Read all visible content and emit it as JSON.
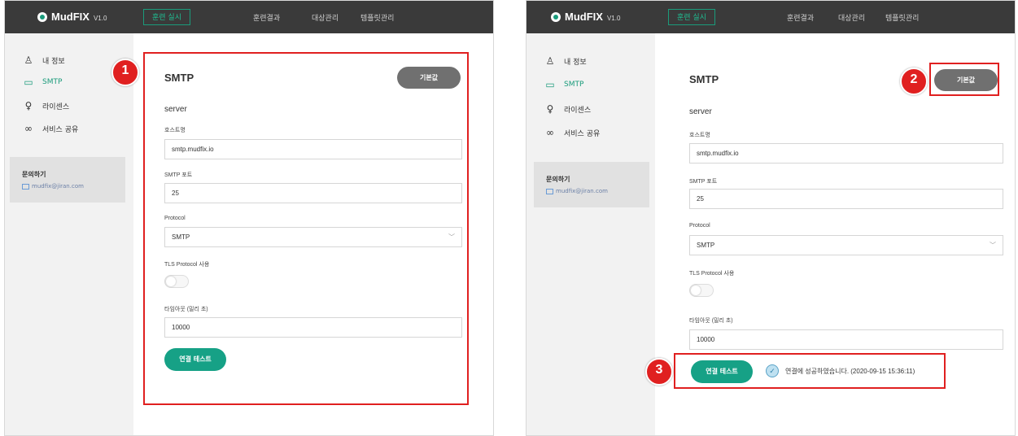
{
  "app": {
    "logo_text": "MudFIX",
    "version": "V1.0"
  },
  "nav": {
    "active": "훈련 실시",
    "items": [
      "훈련결과",
      "대상관리",
      "템플릿관리"
    ]
  },
  "sidebar": {
    "items": [
      {
        "label": "내 정보",
        "icon": "user-icon"
      },
      {
        "label": "SMTP",
        "icon": "monitor-icon",
        "active": true
      },
      {
        "label": "라이센스",
        "icon": "award-icon"
      },
      {
        "label": "서비스 공유",
        "icon": "link-icon"
      }
    ],
    "contact_title": "문의하기",
    "contact_email": "mudfix@jiran.com"
  },
  "form": {
    "title": "SMTP",
    "default_button": "기본값",
    "section": "server",
    "host_label": "호스트명",
    "host_value": "smtp.mudfix.io",
    "port_label": "SMTP 포트",
    "port_value": "25",
    "protocol_label": "Protocol",
    "protocol_value": "SMTP",
    "tls_label": "TLS Protocol 사용",
    "tls_enabled": false,
    "timeout_label": "타임아웃 (밀리 초)",
    "timeout_value": "10000",
    "test_button": "연결 테스트",
    "success_message": "연결에 성공하였습니다. (2020-09-15 15:36:11)"
  },
  "annotations": {
    "badge1": "1",
    "badge2": "2",
    "badge3": "3"
  },
  "colors": {
    "accent": "#1a9b7b",
    "annotation": "#e02020",
    "topbar": "#3a3a3a"
  }
}
